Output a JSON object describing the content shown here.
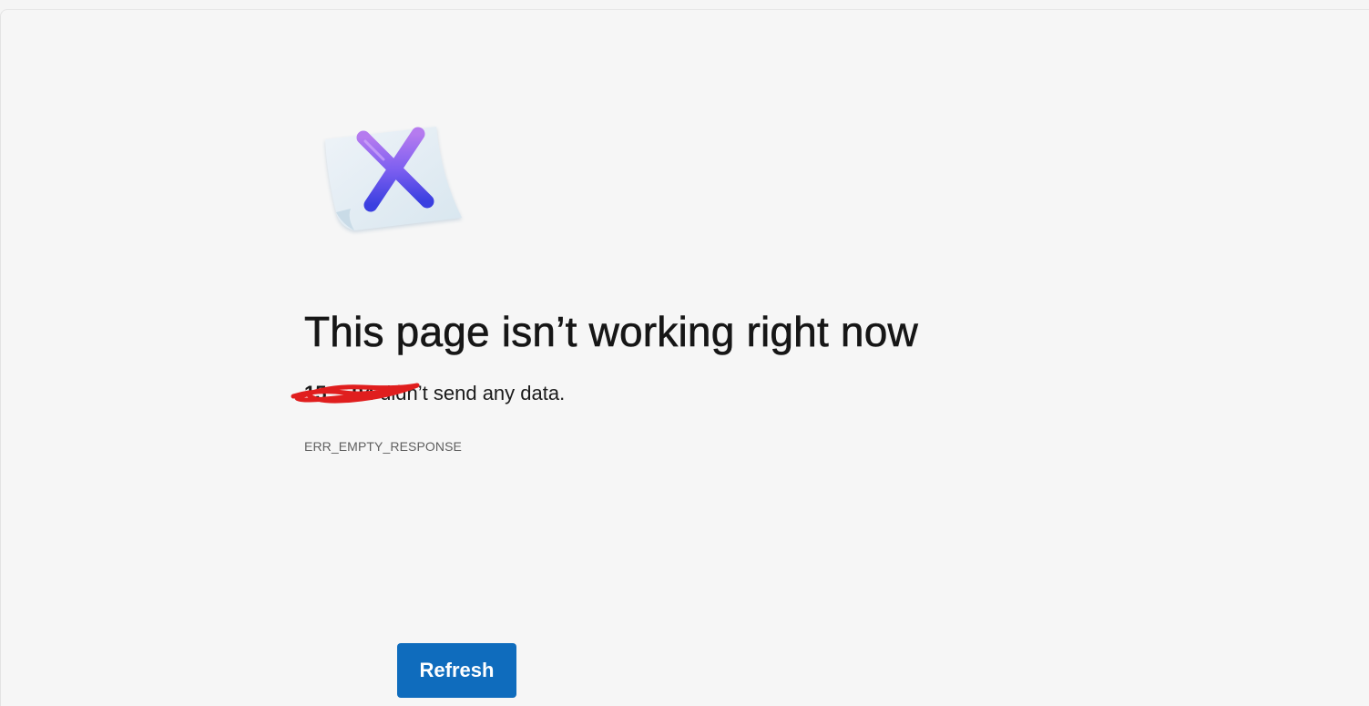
{
  "error_page": {
    "illustration_icon": "error-document-x-icon",
    "title": "This page isn’t working right now",
    "host_redacted": "15.…94",
    "message_suffix": " didn’t send any data.",
    "error_code": "ERR_EMPTY_RESPONSE",
    "refresh_label": "Refresh"
  },
  "colors": {
    "background": "#f6f6f6",
    "button": "#0f6cbd",
    "redaction_scribble": "#e01e1e",
    "x_gradient_top": "#b57bef",
    "x_gradient_bottom": "#3a3fe0"
  }
}
